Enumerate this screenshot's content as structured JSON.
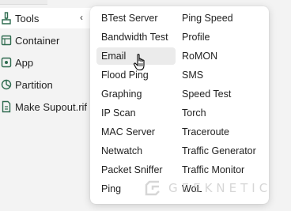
{
  "sidebar": {
    "items": [
      {
        "label": "Tools",
        "icon": "tools-icon",
        "active": true
      },
      {
        "label": "Container",
        "icon": "container-icon"
      },
      {
        "label": "App",
        "icon": "app-icon"
      },
      {
        "label": "Partition",
        "icon": "partition-icon"
      },
      {
        "label": "Make Supout.rif",
        "icon": "supout-icon"
      }
    ],
    "expand_glyph": "‹"
  },
  "submenu": {
    "column1": [
      "BTest Server",
      "Bandwidth Test",
      "Email",
      "Flood Ping",
      "Graphing",
      "IP Scan",
      "MAC Server",
      "Netwatch",
      "Packet Sniffer",
      "Ping"
    ],
    "column2": [
      "Ping Speed",
      "Profile",
      "RoMON",
      "SMS",
      "Speed Test",
      "Torch",
      "Traceroute",
      "Traffic Generator",
      "Traffic Monitor",
      "WoL"
    ],
    "hovered": "Email"
  },
  "watermark": {
    "text": "GEEKNETIC"
  },
  "colors": {
    "background": "#f3f3f3",
    "menu": "#ffffff",
    "hover": "#ebebeb",
    "icon": "#2e6b4f"
  }
}
